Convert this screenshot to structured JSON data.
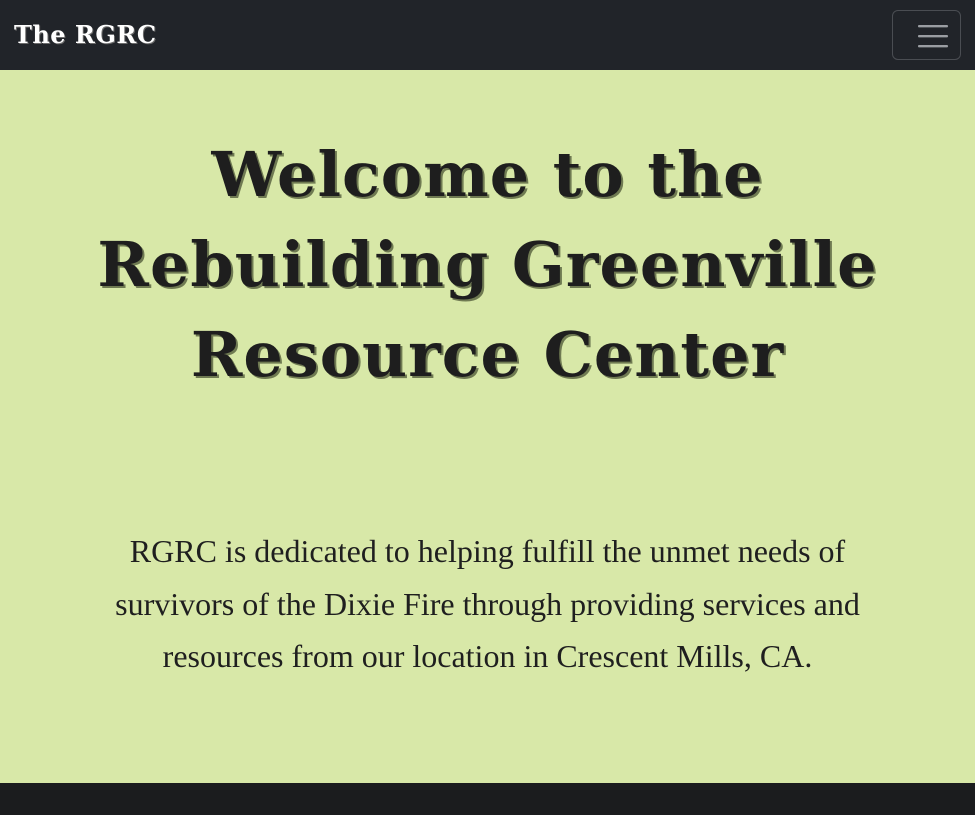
{
  "navbar": {
    "brand": "The RGRC",
    "toggle_icon": "hamburger-menu-icon"
  },
  "hero": {
    "title_lines": [
      "Welcome to the",
      "Rebuilding Greenville",
      "Resource Center"
    ],
    "mission_lines": [
      "RGRC is dedicated to helping fulfill the unmet needs of",
      "survivors of the Dixie Fire through providing services and",
      "resources from our location in Crescent Mills, CA."
    ]
  },
  "colors": {
    "navbar_bg": "#212429",
    "hero_bg": "#d8e8a8",
    "footer_bg": "#1b1c1e",
    "text": "#1e1e1e"
  }
}
